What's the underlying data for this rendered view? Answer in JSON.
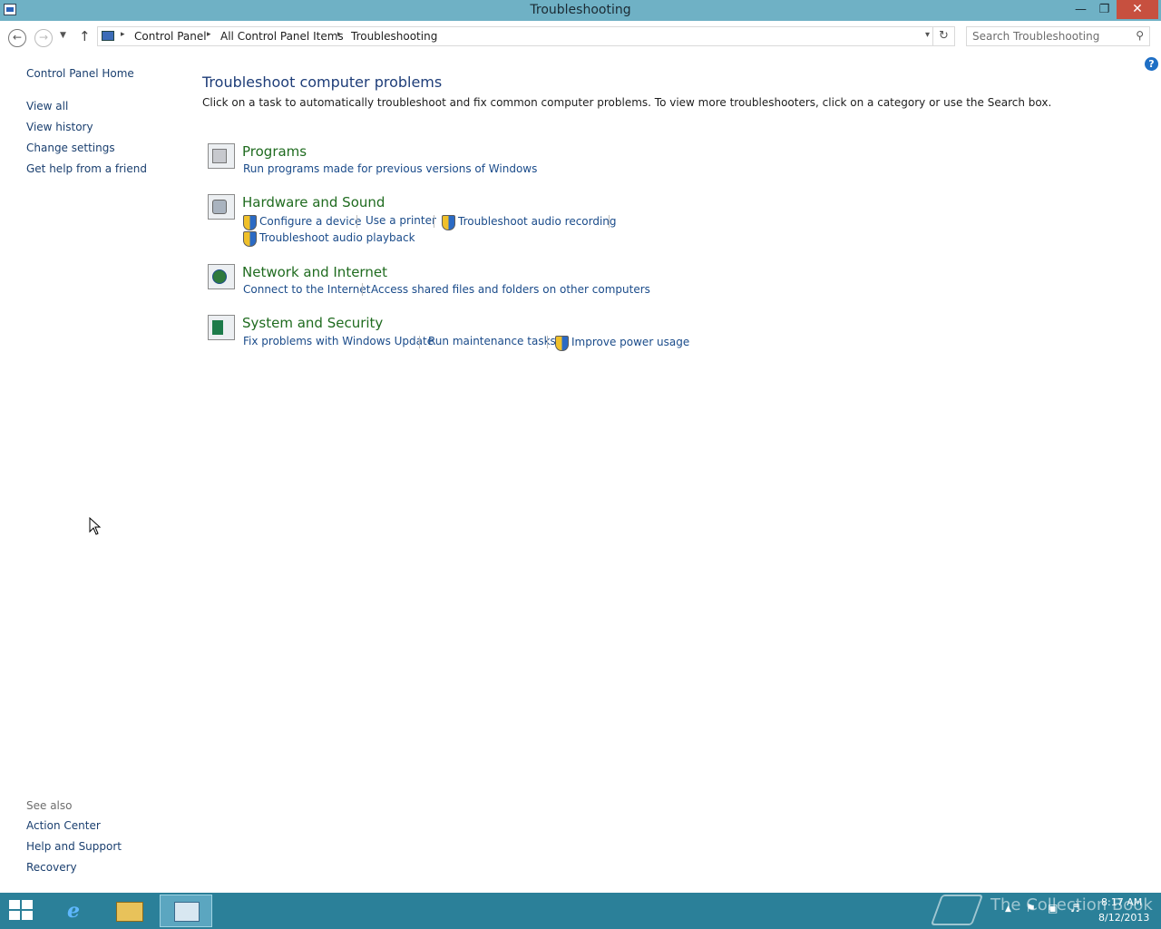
{
  "window": {
    "title": "Troubleshooting",
    "minimize": "—",
    "maximize": "❐",
    "close": "✕"
  },
  "nav": {
    "back": "←",
    "forward": "→",
    "recent": "▼",
    "up": "↑",
    "chevron": "▸",
    "breadcrumbs": [
      "Control Panel",
      "All Control Panel Items",
      "Troubleshooting"
    ],
    "dropdown": "▾",
    "refresh": "↻",
    "search_placeholder": "Search Troubleshooting",
    "search_icon": "search-icon"
  },
  "help": "?",
  "sidebar": {
    "home": "Control Panel Home",
    "links": [
      "View all",
      "View history",
      "Change settings",
      "Get help from a friend"
    ],
    "see_also_label": "See also",
    "see_also": [
      "Action Center",
      "Help and Support",
      "Recovery"
    ]
  },
  "main": {
    "title": "Troubleshoot computer problems",
    "description": "Click on a task to automatically troubleshoot and fix common computer problems. To view more troubleshooters, click on a category or use the Search box.",
    "categories": [
      {
        "title": "Programs",
        "icon": "programs-icon",
        "tasks": [
          "Run programs made for previous versions of Windows"
        ]
      },
      {
        "title": "Hardware and Sound",
        "icon": "hardware-icon",
        "tasks": [
          "Configure a device",
          "Use a printer",
          "Troubleshoot audio recording",
          "Troubleshoot audio playback"
        ]
      },
      {
        "title": "Network and Internet",
        "icon": "network-icon",
        "tasks": [
          "Connect to the Internet",
          "Access shared files and folders on other computers"
        ]
      },
      {
        "title": "System and Security",
        "icon": "security-icon",
        "tasks": [
          "Fix problems with Windows Update",
          "Run maintenance tasks",
          "Improve power usage"
        ]
      }
    ]
  },
  "taskbar": {
    "ie_glyph": "e",
    "watermark": "The Collection Book",
    "time": "8:17 AM",
    "date": "8/12/2013",
    "tray_up": "▲"
  },
  "colors": {
    "titlebar": "#6fb1c5",
    "taskbar": "#2b8099",
    "link": "#1a4b8a",
    "category": "#1f6b1f",
    "heading": "#1e3d78"
  }
}
